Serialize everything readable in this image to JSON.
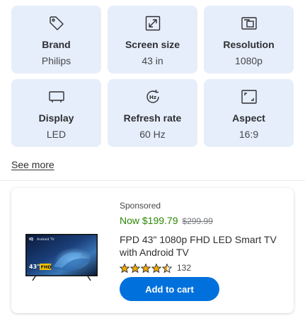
{
  "specs": [
    {
      "icon": "tag-icon",
      "title": "Brand",
      "value": "Philips"
    },
    {
      "icon": "screen-size-icon",
      "title": "Screen size",
      "value": "43 in"
    },
    {
      "icon": "resolution-icon",
      "title": "Resolution",
      "value": "1080p"
    },
    {
      "icon": "display-icon",
      "title": "Display",
      "value": "LED"
    },
    {
      "icon": "refresh-rate-icon",
      "title": "Refresh rate",
      "value": "60 Hz"
    },
    {
      "icon": "aspect-icon",
      "title": "Aspect",
      "value": "16:9"
    }
  ],
  "see_more": "See more",
  "product": {
    "sponsored": "Sponsored",
    "now_price": "Now $199.79",
    "was_price": "$299.99",
    "title": "FPD 43\" 1080p FHD LED Smart TV with Android TV",
    "rating": 4.5,
    "review_count": "132",
    "add_to_cart": "Add to cart",
    "thumb_size_badge": "43\"",
    "thumb_fhd_badge": "FHD",
    "thumb_android": "Android TV"
  },
  "colors": {
    "tile_bg": "#e6eefb",
    "price_green": "#2a8703",
    "button_blue": "#0071dc",
    "star_gold": "#f2a900"
  }
}
